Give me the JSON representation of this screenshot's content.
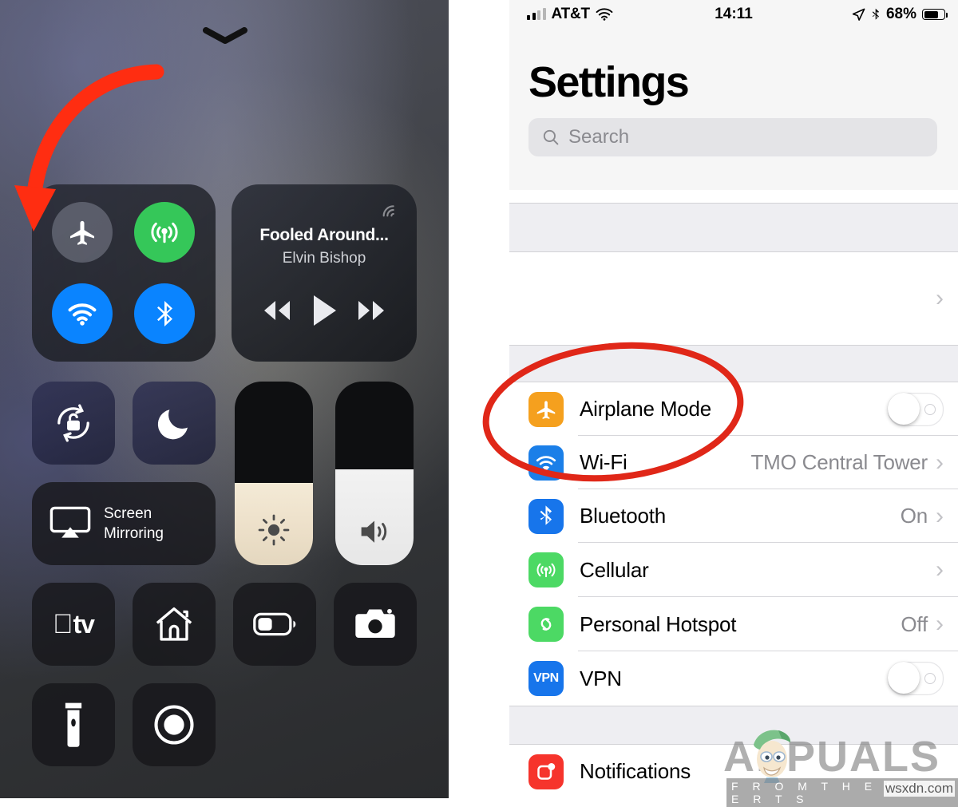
{
  "control_center": {
    "grabber": "chevron-down",
    "connectivity": {
      "airplane": {
        "name": "Airplane Mode",
        "state": "off"
      },
      "cellular": {
        "name": "Cellular Data",
        "state": "on"
      },
      "wifi": {
        "name": "Wi-Fi",
        "state": "on"
      },
      "bluetooth": {
        "name": "Bluetooth",
        "state": "on"
      }
    },
    "now_playing": {
      "title": "Fooled Around...",
      "artist": "Elvin Bishop",
      "airplay": "airplay-audio-icon",
      "controls": [
        "rewind",
        "play",
        "fast-forward"
      ]
    },
    "tiles": {
      "rotation_lock": "Rotation Lock",
      "do_not_disturb": "Do Not Disturb",
      "screen_mirroring_line1": "Screen",
      "screen_mirroring_line2": "Mirroring",
      "apple_tv": "tv",
      "home": "Home",
      "low_power": "Low Power Mode",
      "camera": "Camera",
      "flashlight": "Flashlight",
      "screen_record": "Screen Recording"
    },
    "sliders": {
      "brightness_label": "Brightness",
      "brightness_percent": 45,
      "volume_label": "Volume",
      "volume_percent": 52
    }
  },
  "settings": {
    "status_bar": {
      "carrier": "AT&T",
      "signal_bars_filled": 2,
      "signal_bars_total": 4,
      "wifi": "wifi-icon",
      "time": "14:11",
      "location": "location-arrow-icon",
      "bluetooth": "bluetooth-icon",
      "battery_percent": "68%",
      "battery_level": 68
    },
    "title": "Settings",
    "search": {
      "placeholder": "Search",
      "value": "",
      "icon": "search-icon"
    },
    "apple_id_row": {
      "label": "",
      "chevron": "›"
    },
    "groups": [
      {
        "rows": [
          {
            "label": "Airplane Mode",
            "icon": "airplane-icon",
            "icon_color": "#F5A01E",
            "accessory": "toggle",
            "toggle_state": "off"
          },
          {
            "label": "Wi-Fi",
            "icon": "wifi-icon",
            "icon_color": "#1B7FE8",
            "accessory": "value",
            "value": "TMO Central Tower"
          },
          {
            "label": "Bluetooth",
            "icon": "bluetooth-icon",
            "icon_color": "#1775EB",
            "accessory": "value",
            "value": "On"
          },
          {
            "label": "Cellular",
            "icon": "cellular-icon",
            "icon_color": "#4CD964",
            "accessory": "value",
            "value": ""
          },
          {
            "label": "Personal Hotspot",
            "icon": "hotspot-icon",
            "icon_color": "#4CD964",
            "accessory": "value",
            "value": "Off"
          },
          {
            "label": "VPN",
            "icon": "vpn-icon",
            "icon_color": "#1775EB",
            "icon_text": "VPN",
            "accessory": "toggle",
            "toggle_state": "off"
          }
        ]
      },
      {
        "rows": [
          {
            "label": "Notifications",
            "icon": "notifications-icon",
            "icon_color": "#F6342C",
            "accessory": "none",
            "value": ""
          }
        ]
      }
    ]
  },
  "annotations": {
    "arrow": {
      "color": "#FF2D11",
      "target": "airplane-mode-toggle"
    },
    "ellipse": {
      "color": "#E02718",
      "target": "airplane-mode-row"
    }
  },
  "watermark": {
    "brand": "APPUALS",
    "tagline": "F R O M  T H E  E X P E R T S",
    "site": "wsxdn.com"
  }
}
